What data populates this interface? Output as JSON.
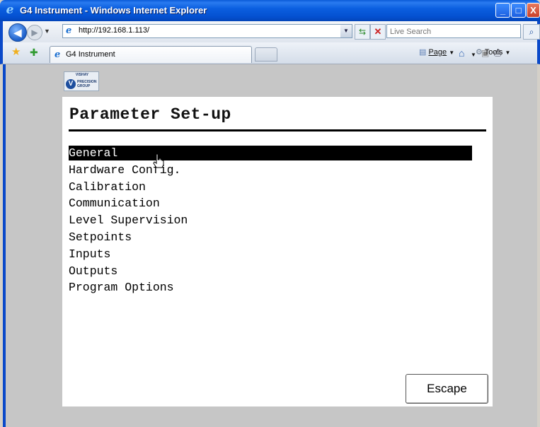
{
  "window": {
    "title": "G4 Instrument - Windows Internet Explorer",
    "minimize_glyph": "_",
    "maximize_glyph": "□",
    "close_glyph": "X"
  },
  "address": {
    "url": "http://192.168.1.113/",
    "search_placeholder": "Live Search"
  },
  "tabs": [
    {
      "label": "G4 Instrument"
    }
  ],
  "commands": {
    "page_label": "Page",
    "tools_label": "Tools"
  },
  "logo": {
    "top_text": "VISHAY",
    "sub_text": "PRECISION GROUP",
    "mark": "V"
  },
  "panel": {
    "title": "Parameter Set-up",
    "menu_items": [
      {
        "label": "General",
        "selected": true
      },
      {
        "label": "Hardware Config.",
        "selected": false
      },
      {
        "label": "Calibration",
        "selected": false
      },
      {
        "label": "Communication",
        "selected": false
      },
      {
        "label": "Level Supervision",
        "selected": false
      },
      {
        "label": "Setpoints",
        "selected": false
      },
      {
        "label": "Inputs",
        "selected": false
      },
      {
        "label": "Outputs",
        "selected": false
      },
      {
        "label": "Program Options",
        "selected": false
      }
    ],
    "escape_label": "Escape"
  },
  "colors": {
    "titlebar": "#0b5fe0",
    "selection_bg": "#000000",
    "selection_fg": "#ffffff",
    "viewport_bg": "#c6c6c6"
  }
}
